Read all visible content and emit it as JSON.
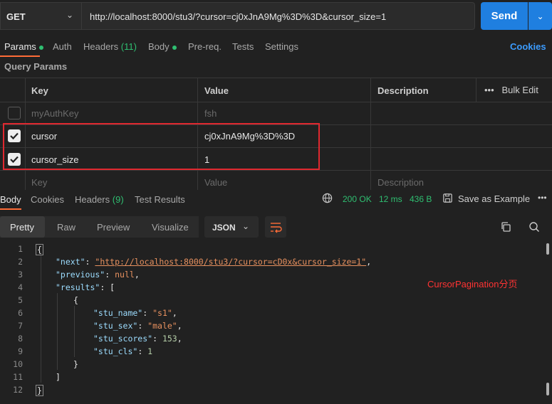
{
  "request": {
    "method": "GET",
    "url": "http://localhost:8000/stu3/?cursor=cj0xJnA9Mg%3D%3D&cursor_size=1",
    "send_label": "Send"
  },
  "tabs": {
    "params": "Params",
    "auth": "Auth",
    "headers": "Headers",
    "headers_count": "(11)",
    "body": "Body",
    "prereq": "Pre-req.",
    "tests": "Tests",
    "settings": "Settings",
    "cookies": "Cookies"
  },
  "query_params": {
    "title": "Query Params",
    "columns": {
      "key": "Key",
      "value": "Value",
      "description": "Description"
    },
    "bulk_edit": "Bulk Edit",
    "rows": [
      {
        "key": "myAuthKey",
        "value": "fsh",
        "checked": false
      },
      {
        "key": "cursor",
        "value": "cj0xJnA9Mg%3D%3D",
        "checked": true
      },
      {
        "key": "cursor_size",
        "value": "1",
        "checked": true
      }
    ],
    "placeholder": {
      "key": "Key",
      "value": "Value",
      "description": "Description"
    }
  },
  "response": {
    "tabs": {
      "body": "Body",
      "cookies": "Cookies",
      "headers": "Headers",
      "headers_count": "(9)",
      "test_results": "Test Results"
    },
    "status": "200 OK",
    "time": "12 ms",
    "size": "436 B",
    "save_example": "Save as Example",
    "views": {
      "pretty": "Pretty",
      "raw": "Raw",
      "preview": "Preview",
      "visualize": "Visualize"
    },
    "format": "JSON",
    "line_numbers": [
      "1",
      "2",
      "3",
      "4",
      "5",
      "6",
      "7",
      "8",
      "9",
      "10",
      "11",
      "12"
    ],
    "body": {
      "next_key": "\"next\"",
      "next_val": "\"http://localhost:8000/stu3/?cursor=cD0x&cursor_size=1\"",
      "previous_key": "\"previous\"",
      "previous_val": "null",
      "results_key": "\"results\"",
      "stu_name_key": "\"stu_name\"",
      "stu_name_val": "\"s1\"",
      "stu_sex_key": "\"stu_sex\"",
      "stu_sex_val": "\"male\"",
      "stu_scores_key": "\"stu_scores\"",
      "stu_scores_val": "153",
      "stu_cls_key": "\"stu_cls\"",
      "stu_cls_val": "1"
    },
    "annotation": "CursorPagination分页"
  },
  "colors": {
    "accent": "#ff6c37",
    "send": "#1f7fe0",
    "status_ok": "#2fbf71",
    "annotation": "#ff3333",
    "highlight_box": "#e0282f"
  }
}
